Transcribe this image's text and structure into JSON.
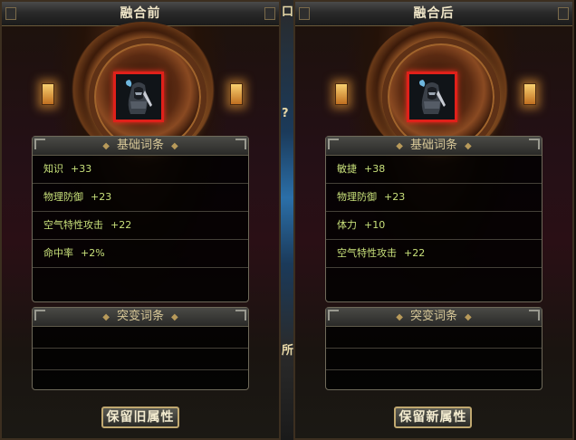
{
  "before": {
    "title": "融合前",
    "base_header": "基础词条",
    "mutation_header": "突变词条",
    "attributes": [
      {
        "name": "知识",
        "value": "+33"
      },
      {
        "name": "物理防御",
        "value": "+23"
      },
      {
        "name": "空气特性攻击",
        "value": "+22"
      },
      {
        "name": "命中率",
        "value": "+2%"
      }
    ],
    "button": "保留旧属性"
  },
  "after": {
    "title": "融合后",
    "base_header": "基础词条",
    "mutation_header": "突变词条",
    "attributes": [
      {
        "name": "敏捷",
        "value": "+38"
      },
      {
        "name": "物理防御",
        "value": "+23"
      },
      {
        "name": "体力",
        "value": "+10"
      },
      {
        "name": "空气特性攻击",
        "value": "+22"
      }
    ],
    "button": "保留新属性"
  },
  "gap": {
    "mark_top": "口",
    "mark_mid": "?",
    "mark_bottom": "所"
  },
  "colors": {
    "attribute_text": "#c8e07a",
    "item_frame": "#e0201a",
    "header_text": "#d8c898"
  },
  "icons": {
    "item": "hooded-warrior-icon"
  }
}
